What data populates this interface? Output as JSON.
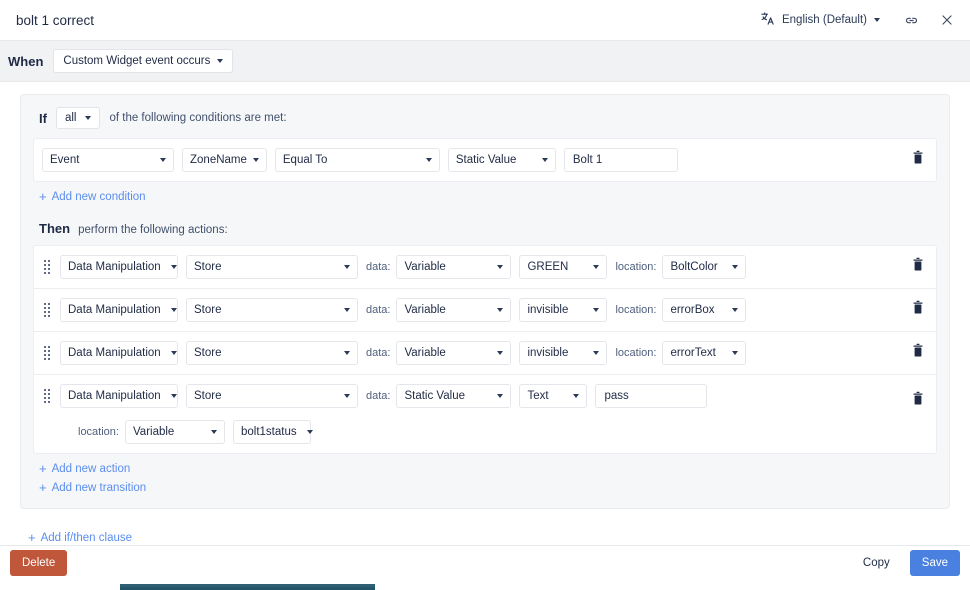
{
  "titlebar": {
    "doc_title": "bolt 1 correct",
    "language_label": "English (Default)",
    "translate_icon": "translate-icon",
    "link_icon": "link-icon",
    "close_icon": "close-icon"
  },
  "when": {
    "label": "When",
    "trigger": "Custom Widget event occurs"
  },
  "clause": {
    "if": {
      "word": "If",
      "match": "all",
      "note": "of the following conditions are met:",
      "conditions": [
        {
          "source": "Event",
          "field": "ZoneName",
          "operator": "Equal To",
          "value_type": "Static Value",
          "value": "Bolt 1"
        }
      ],
      "add_condition": "Add new condition"
    },
    "then": {
      "word": "Then",
      "note": "perform the following actions:",
      "actions": [
        {
          "type": "Data Manipulation",
          "operation": "Store",
          "data_label": "data:",
          "data_type": "Variable",
          "data_value": "GREEN",
          "location_label": "location:",
          "location_value": "BoltColor",
          "second_line": false
        },
        {
          "type": "Data Manipulation",
          "operation": "Store",
          "data_label": "data:",
          "data_type": "Variable",
          "data_value": "invisible",
          "location_label": "location:",
          "location_value": "errorBox",
          "second_line": false
        },
        {
          "type": "Data Manipulation",
          "operation": "Store",
          "data_label": "data:",
          "data_type": "Variable",
          "data_value": "invisible",
          "location_label": "location:",
          "location_value": "errorText",
          "second_line": false
        },
        {
          "type": "Data Manipulation",
          "operation": "Store",
          "data_label": "data:",
          "data_type": "Static Value",
          "data_value": "Text",
          "text_value": "pass",
          "location_label": "location:",
          "location_type": "Variable",
          "location_value": "bolt1status",
          "second_line": true
        }
      ],
      "add_action": "Add new action",
      "add_transition": "Add new transition"
    },
    "add_clause": "Add if/then clause"
  },
  "footer": {
    "delete_label": "Delete",
    "copy_label": "Copy",
    "save_label": "Save",
    "delete_color": "#c0563a",
    "save_color": "#4a80e0"
  }
}
